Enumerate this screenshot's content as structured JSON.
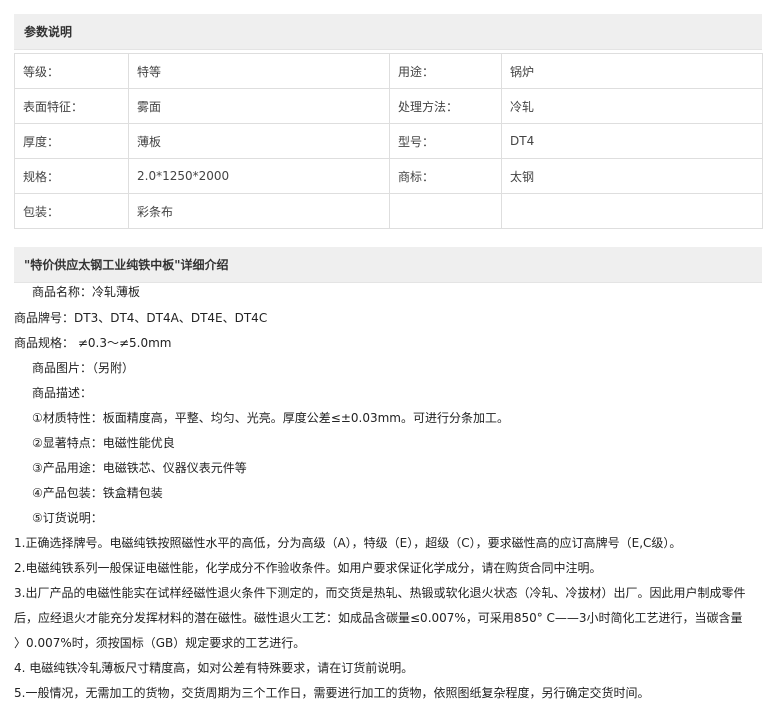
{
  "params": {
    "title": "参数说明",
    "rows": [
      [
        "等级：",
        "特等",
        "用途：",
        "锅炉"
      ],
      [
        "表面特征：",
        "雾面",
        "处理方法：",
        "冷轧"
      ],
      [
        "厚度：",
        "薄板",
        "型号：",
        "DT4"
      ],
      [
        "规格：",
        "2.0*1250*2000",
        "商标：",
        "太钢"
      ],
      [
        "包装：",
        "彩条布",
        "",
        ""
      ]
    ]
  },
  "detail": {
    "title": "\"特价供应太钢工业纯铁中板\"详细介绍",
    "lines": [
      "商品名称：冷轧薄板",
      "商品牌号：DT3、DT4、DT4A、DT4E、DT4C",
      "商品规格：  ≠0.3～≠5.0mm",
      "商品图片：（另附）",
      "商品描述：",
      "①材质特性：板面精度高，平整、均匀、光亮。厚度公差≤±0.03mm。可进行分条加工。",
      "②显著特点：电磁性能优良",
      "③产品用途：电磁铁芯、仪器仪表元件等",
      "④产品包装：铁盒精包装",
      "⑤订货说明：",
      "1.正确选择牌号。电磁纯铁按照磁性水平的高低，分为高级（A），特级（E），超级（C），要求磁性高的应订高牌号（E,C级）。",
      "2.电磁纯铁系列一般保证电磁性能，化学成分不作验收条件。如用户要求保证化学成分，请在购货合同中注明。",
      "3.出厂产品的电磁性能实在试样经磁性退火条件下测定的，而交货是热轧、热锻或软化退火状态（冷轧、冷拔材）出厂。因此用户制成零件",
      "后，应经退火才能充分发挥材料的潜在磁性。磁性退火工艺：如成品含碳量≤0.007%，可采用850° C——3小时简化工艺进行，当碳含量",
      "〉0.007%时，须按国标（GB）规定要求的工艺进行。",
      "4. 电磁纯铁冷轧薄板尺寸精度高，如对公差有特殊要求，请在订货前说明。",
      "5.一般情况，无需加工的货物，交货周期为三个工作日，需要进行加工的货物，依照图纸复杂程度，另行确定交货时间。"
    ]
  }
}
